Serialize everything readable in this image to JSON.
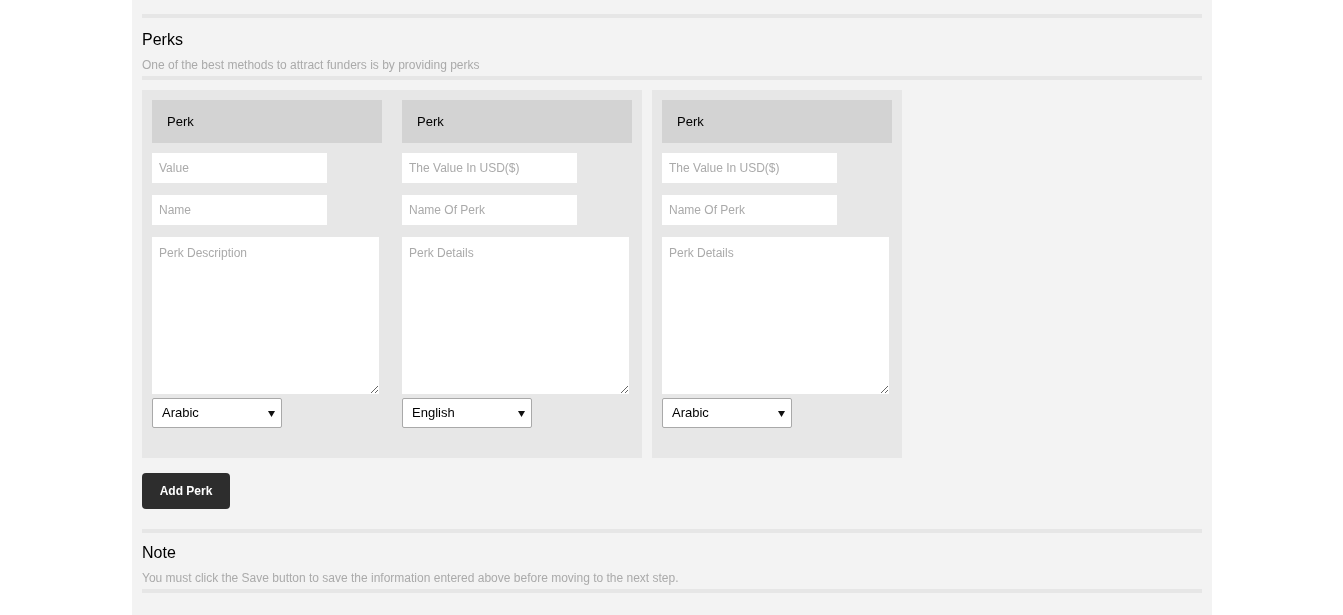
{
  "perks_section": {
    "title": "Perks",
    "subtitle": "One of the best methods to attract funders is by providing perks"
  },
  "perk_groups": [
    {
      "perks": [
        {
          "header": "Perk",
          "value_placeholder": "Value",
          "name_placeholder": "Name",
          "description_placeholder": "Perk Description",
          "language": "Arabic"
        },
        {
          "header": "Perk",
          "value_placeholder": "The Value In USD($)",
          "name_placeholder": "Name Of Perk",
          "description_placeholder": "Perk Details",
          "language": "English"
        }
      ]
    },
    {
      "perks": [
        {
          "header": "Perk",
          "value_placeholder": "The Value In USD($)",
          "name_placeholder": "Name Of Perk",
          "description_placeholder": "Perk Details",
          "language": "Arabic"
        }
      ]
    }
  ],
  "add_button": "Add Perk",
  "note_section": {
    "title": "Note",
    "text": "You must click the Save button to save the information entered above before moving to the next step."
  }
}
